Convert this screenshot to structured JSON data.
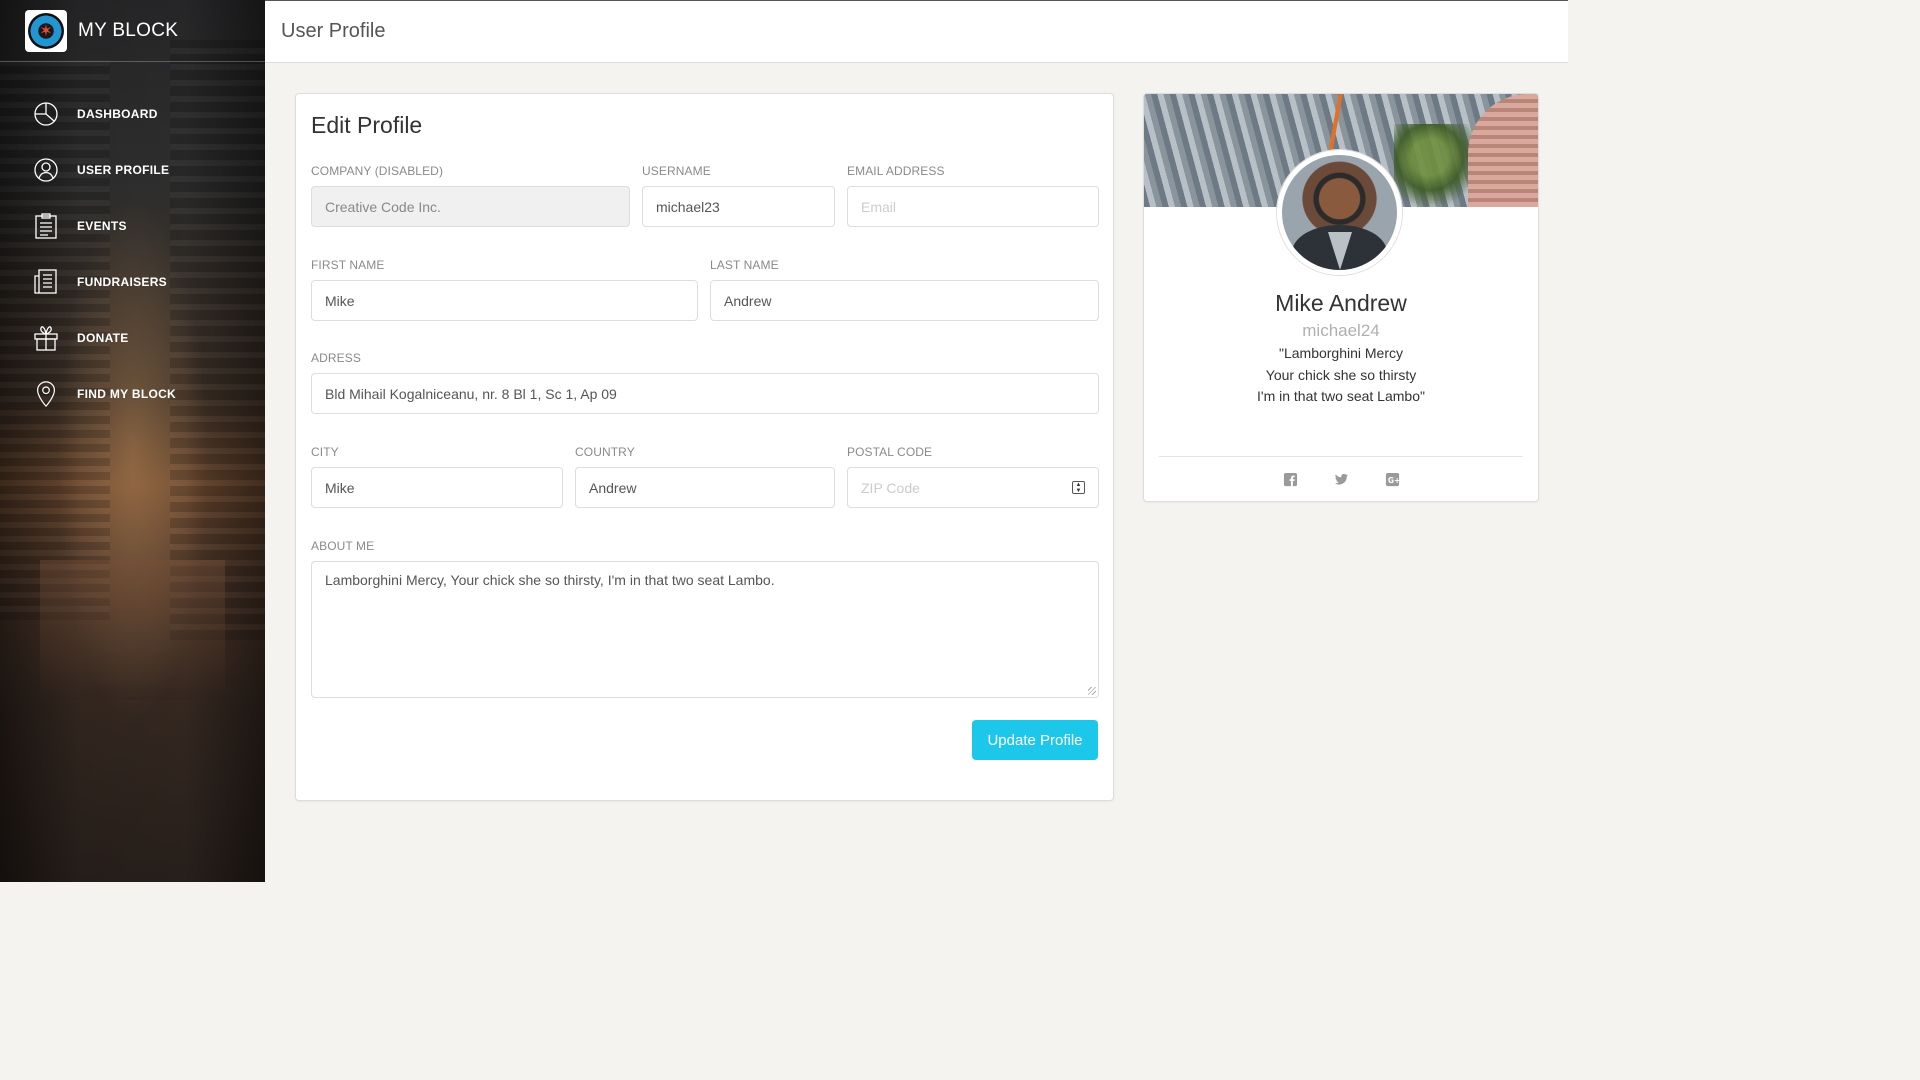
{
  "brand": {
    "title": "MY BLOCK"
  },
  "sidebar": {
    "items": [
      {
        "label": "DASHBOARD",
        "icon": "pie-chart-icon"
      },
      {
        "label": "USER PROFILE",
        "icon": "user-icon"
      },
      {
        "label": "EVENTS",
        "icon": "clipboard-icon"
      },
      {
        "label": "FUNDRAISERS",
        "icon": "news-icon"
      },
      {
        "label": "DONATE",
        "icon": "gift-icon"
      },
      {
        "label": "FIND MY BLOCK",
        "icon": "map-pin-icon"
      }
    ]
  },
  "header": {
    "title": "User Profile"
  },
  "edit_profile": {
    "title": "Edit Profile",
    "company": {
      "label": "Company (disabled)",
      "value": "Creative Code Inc."
    },
    "username": {
      "label": "Username",
      "value": "michael23"
    },
    "email": {
      "label": "Email address",
      "placeholder": "Email"
    },
    "first_name": {
      "label": "First Name",
      "value": "Mike"
    },
    "last_name": {
      "label": "Last Name",
      "value": "Andrew"
    },
    "address": {
      "label": "Adress",
      "value": "Bld Mihail Kogalniceanu, nr. 8 Bl 1, Sc 1, Ap 09"
    },
    "city": {
      "label": "City",
      "value": "Mike"
    },
    "country": {
      "label": "Country",
      "value": "Andrew"
    },
    "postal_code": {
      "label": "Postal Code",
      "placeholder": "ZIP Code"
    },
    "about": {
      "label": "About Me",
      "value": "Lamborghini Mercy, Your chick she so thirsty, I'm in that two seat Lambo."
    },
    "submit_label": "Update Profile"
  },
  "profile_card": {
    "name": "Mike Andrew",
    "username": "michael24",
    "quote_lines": [
      "\"Lamborghini Mercy",
      "Your chick she so thirsty",
      "I'm in that two seat Lambo\""
    ],
    "socials": [
      "facebook-icon",
      "twitter-icon",
      "google-plus-icon"
    ]
  },
  "colors": {
    "accent": "#1dc7ea",
    "sidebar_text": "#ffffff",
    "page_bg": "#f4f3ef"
  }
}
